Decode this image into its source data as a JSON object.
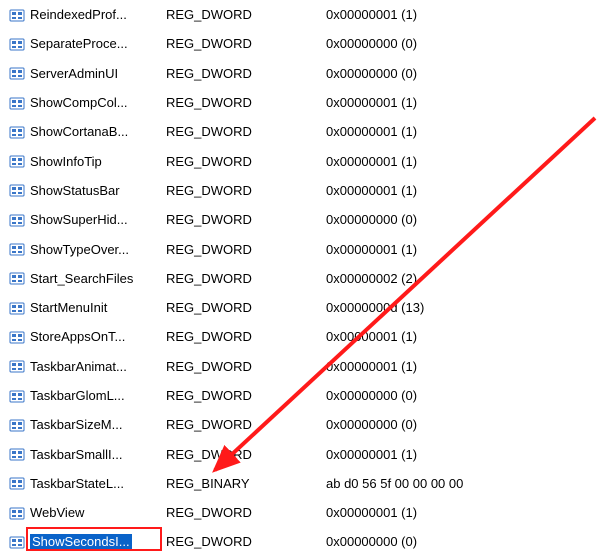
{
  "registry": {
    "entries": [
      {
        "name": "ReindexedProf...",
        "type": "REG_DWORD",
        "data": "0x00000001 (1)"
      },
      {
        "name": "SeparateProce...",
        "type": "REG_DWORD",
        "data": "0x00000000 (0)"
      },
      {
        "name": "ServerAdminUI",
        "type": "REG_DWORD",
        "data": "0x00000000 (0)"
      },
      {
        "name": "ShowCompCol...",
        "type": "REG_DWORD",
        "data": "0x00000001 (1)"
      },
      {
        "name": "ShowCortanaB...",
        "type": "REG_DWORD",
        "data": "0x00000001 (1)"
      },
      {
        "name": "ShowInfoTip",
        "type": "REG_DWORD",
        "data": "0x00000001 (1)"
      },
      {
        "name": "ShowStatusBar",
        "type": "REG_DWORD",
        "data": "0x00000001 (1)"
      },
      {
        "name": "ShowSuperHid...",
        "type": "REG_DWORD",
        "data": "0x00000000 (0)"
      },
      {
        "name": "ShowTypeOver...",
        "type": "REG_DWORD",
        "data": "0x00000001 (1)"
      },
      {
        "name": "Start_SearchFiles",
        "type": "REG_DWORD",
        "data": "0x00000002 (2)"
      },
      {
        "name": "StartMenuInit",
        "type": "REG_DWORD",
        "data": "0x0000000d (13)"
      },
      {
        "name": "StoreAppsOnT...",
        "type": "REG_DWORD",
        "data": "0x00000001 (1)"
      },
      {
        "name": "TaskbarAnimat...",
        "type": "REG_DWORD",
        "data": "0x00000001 (1)"
      },
      {
        "name": "TaskbarGlomL...",
        "type": "REG_DWORD",
        "data": "0x00000000 (0)"
      },
      {
        "name": "TaskbarSizeM...",
        "type": "REG_DWORD",
        "data": "0x00000000 (0)"
      },
      {
        "name": "TaskbarSmallI...",
        "type": "REG_DWORD",
        "data": "0x00000001 (1)"
      },
      {
        "name": "TaskbarStateL...",
        "type": "REG_BINARY",
        "data": "ab d0 56 5f 00 00 00 00"
      },
      {
        "name": "WebView",
        "type": "REG_DWORD",
        "data": "0x00000001 (1)"
      },
      {
        "name": "ShowSecondsI...",
        "type": "REG_DWORD",
        "data": "0x00000000 (0)",
        "selected": true
      }
    ]
  },
  "annotation": {
    "arrow_color": "#ff1a1a",
    "highlight_color": "#ff1a1a"
  }
}
